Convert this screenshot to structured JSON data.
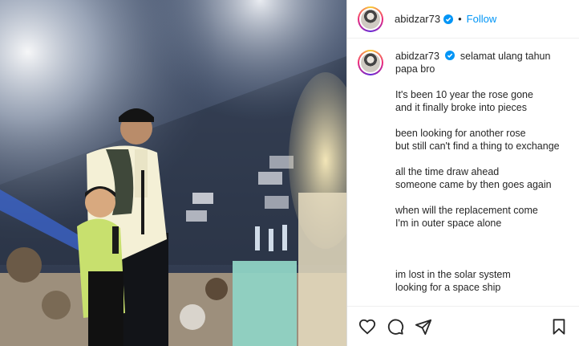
{
  "post": {
    "username": "abidzar73",
    "follow_label": "Follow",
    "separator": "•",
    "caption_lines": [
      [
        "selamat ulang tahun",
        "papa bro"
      ],
      [
        "It's been 10 year the rose gone",
        "and it finally broke into pieces"
      ],
      [
        "been looking for another rose",
        "but still can't find a thing to exchange"
      ],
      [
        "all the time draw ahead",
        "someone came by then goes again"
      ],
      [
        "when will the replacement come",
        "I'm in outer space alone"
      ],
      [
        "im lost in the solar system",
        "looking for a space ship"
      ]
    ]
  },
  "icons": {
    "verified": "verified-badge-icon",
    "like": "heart-icon",
    "comment": "comment-bubble-icon",
    "share": "paper-plane-icon",
    "save": "bookmark-icon"
  },
  "colors": {
    "link": "#0095f6",
    "text": "#262626",
    "border": "#dbdbdb"
  }
}
